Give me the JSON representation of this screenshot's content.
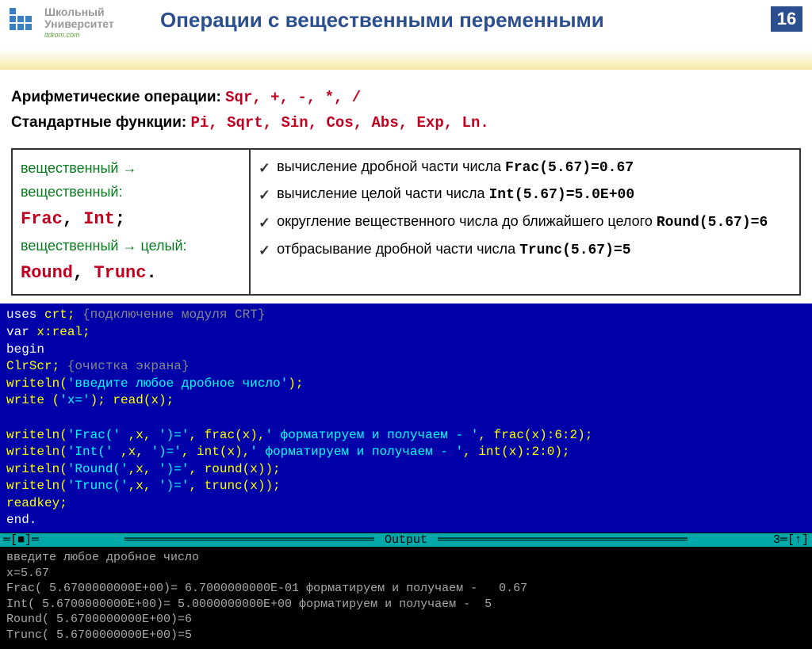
{
  "header": {
    "logo_line1": "Школьный",
    "logo_line2": "Университет",
    "logo_sub": "itdrom.com",
    "title": "Операции с вещественными переменными",
    "page": "16"
  },
  "section1": {
    "label1": "Арифметические операции: ",
    "ops": "Sqr, +, -, *, /",
    "label2": "Стандартные функции: ",
    "funcs": "Pi, Sqrt, Sin, Cos, Abs, Exp, Ln."
  },
  "left_col": {
    "line1": "вещественный → вещественный:",
    "line2a": "Frac",
    "line2b": ", ",
    "line2c": "Int",
    "line2d": ";",
    "line3": "вещественный → целый:",
    "line4a": "Round",
    "line4b": ", ",
    "line4c": "Trunc",
    "line4d": "."
  },
  "right_col": {
    "items": [
      {
        "text": "вычисление дробной части числа ",
        "code": "Frac(5.67)=0.67"
      },
      {
        "text": "вычисление целой части числа ",
        "code": "Int(5.67)=5.0E+00"
      },
      {
        "text": "округление вещественного числа до ближайшего целого ",
        "code": "Round(5.67)=6"
      },
      {
        "text": "отбрасывание дробной части числа ",
        "code": "Trunc(5.67)=5"
      }
    ]
  },
  "code_editor": {
    "line1a": "uses",
    "line1b": " crt;     ",
    "line1c": "{подключение модуля CRT}",
    "line2a": "var",
    "line2b": " x:real;",
    "line3": "begin",
    "line4a": "ClrScr; ",
    "line4c": "{очистка экрана}",
    "line5a": "writeln(",
    "line5b": "'введите любое дробное число'",
    "line5c": ");",
    "line6a": "write (",
    "line6b": "'x='",
    "line6c": "); read(x);",
    "line7": "",
    "line8a": "writeln(",
    "line8b": "'Frac('",
    "line8c": " ,x, ",
    "line8d": "')='",
    "line8e": ", frac(x),",
    "line8f": "' форматируем и получаем - '",
    "line8g": ", frac(x):6:2);",
    "line9a": "writeln(",
    "line9b": "'Int('",
    "line9c": "  ,x, ",
    "line9d": "')='",
    "line9e": ", int(x),",
    "line9f": "' форматируем и получаем - '",
    "line9g": ", int(x):2:0);",
    "line10a": "writeln(",
    "line10b": "'Round('",
    "line10c": ",x, ",
    "line10d": "')='",
    "line10e": ", round(x));",
    "line11a": "writeln(",
    "line11b": "'Trunc('",
    "line11c": ",x, ",
    "line11d": "')='",
    "line11e": ", trunc(x));",
    "line12": "readkey;",
    "line13": "end."
  },
  "output_label": " Output ",
  "output_marks": "3═[↑]",
  "output_term": "введите любое дробное число\nx=5.67\nFrac( 5.6700000000E+00)= 6.7000000000E-01 форматируем и получаем -   0.67\nInt( 5.6700000000E+00)= 5.0000000000E+00 форматируем и получаем -  5\nRound( 5.6700000000E+00)=6\nTrunc( 5.6700000000E+00)=5"
}
